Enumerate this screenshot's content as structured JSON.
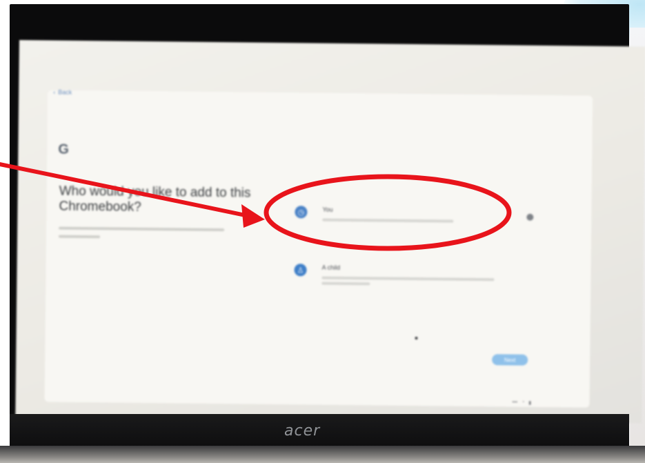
{
  "back": {
    "label": "Back"
  },
  "setup": {
    "heading": "Who would you like to add to this Chromebook?",
    "options": [
      {
        "title": "You",
        "icon": "person-clock-icon"
      },
      {
        "title": "A child",
        "icon": "child-icon"
      }
    ],
    "next_label": "Next"
  },
  "laptop": {
    "brand": "acer"
  },
  "colors": {
    "annotation": "#e8141b",
    "accent": "#8fc1ea",
    "option_icon": "#4a82c6"
  }
}
